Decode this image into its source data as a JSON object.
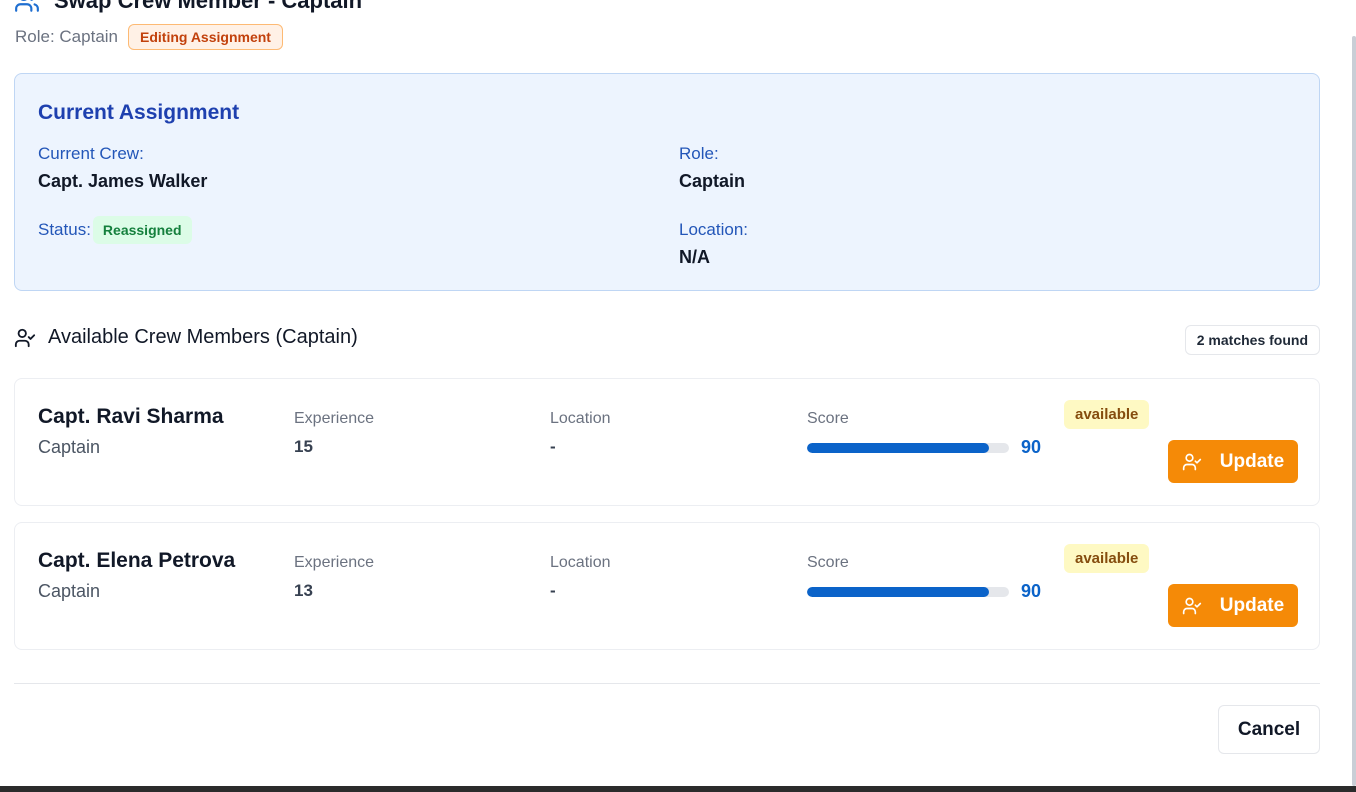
{
  "header": {
    "title": "Swap Crew Member - Captain",
    "role_text": "Role: Captain",
    "badge": "Editing Assignment"
  },
  "current_assignment": {
    "title": "Current Assignment",
    "crew_label": "Current Crew:",
    "crew_value": "Capt. James Walker",
    "role_label": "Role:",
    "role_value": "Captain",
    "status_label": "Status:",
    "status_value": "Reassigned",
    "location_label": "Location:",
    "location_value": "N/A"
  },
  "available": {
    "title": "Available Crew Members (Captain)",
    "matches": "2 matches found",
    "experience_label": "Experience",
    "location_label": "Location",
    "score_label": "Score",
    "crew": [
      {
        "name": "Capt. Ravi Sharma",
        "role": "Captain",
        "experience": "15",
        "location": "-",
        "score": "90",
        "score_pct": 90,
        "status": "available",
        "action_label": "Update"
      },
      {
        "name": "Capt. Elena Petrova",
        "role": "Captain",
        "experience": "13",
        "location": "-",
        "score": "90",
        "score_pct": 90,
        "status": "available",
        "action_label": "Update"
      }
    ]
  },
  "footer": {
    "cancel_label": "Cancel"
  },
  "colors": {
    "accent": "#f58a07",
    "score_bar": "#0b63c9",
    "card_bg": "#edf4fe"
  },
  "icons": {
    "header": "users-icon",
    "section": "user-check-icon",
    "update": "user-check-icon"
  }
}
